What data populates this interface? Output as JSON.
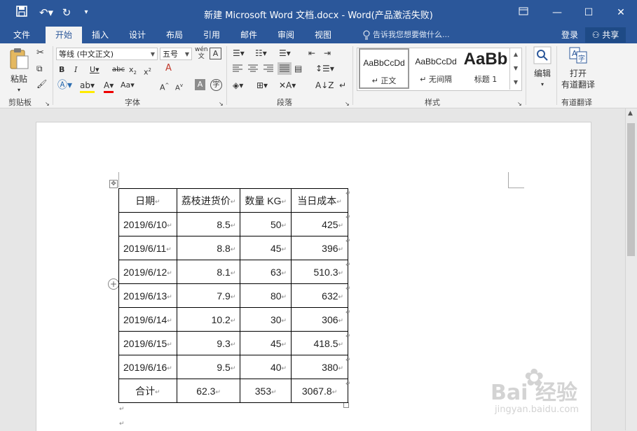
{
  "qat": {
    "save_icon": "save-icon",
    "undo_icon": "undo-icon",
    "redo_icon": "redo-icon",
    "customize_icon": "customize-icon"
  },
  "window": {
    "title": "新建 Microsoft Word 文档.docx - Word(产品激活失败)"
  },
  "tabs": [
    "文件",
    "开始",
    "插入",
    "设计",
    "布局",
    "引用",
    "邮件",
    "审阅",
    "视图"
  ],
  "active_tab": "开始",
  "tellme": "告诉我您想要做什么...",
  "account": {
    "login": "登录",
    "share": "共享"
  },
  "clipboard": {
    "paste": "粘贴",
    "label": "剪贴板"
  },
  "font": {
    "name": "等线 (中文正文)",
    "size": "五号",
    "label": "字体",
    "phonetic": "wén"
  },
  "paragraph": {
    "label": "段落"
  },
  "styles": {
    "items": [
      {
        "sample": "AaBbCcDd",
        "name": "↵ 正文"
      },
      {
        "sample": "AaBbCcDd",
        "name": "↵ 无间隔"
      },
      {
        "sample": "AaBb",
        "name": "标题 1"
      }
    ],
    "label": "样式"
  },
  "editing": {
    "label": "编辑"
  },
  "youdao": {
    "line1": "打开",
    "line2": "有道翻译",
    "label": "有道翻译"
  },
  "table": {
    "headers": [
      "日期",
      "荔枝进货价",
      "数量 KG",
      "当日成本"
    ],
    "rows": [
      [
        "2019/6/10",
        "8.5",
        "50",
        "425"
      ],
      [
        "2019/6/11",
        "8.8",
        "45",
        "396"
      ],
      [
        "2019/6/12",
        "8.1",
        "63",
        "510.3"
      ],
      [
        "2019/6/13",
        "7.9",
        "80",
        "632"
      ],
      [
        "2019/6/14",
        "10.2",
        "30",
        "306"
      ],
      [
        "2019/6/15",
        "9.3",
        "45",
        "418.5"
      ],
      [
        "2019/6/16",
        "9.5",
        "40",
        "380"
      ],
      [
        "合计",
        "62.3",
        "353",
        "3067.8"
      ]
    ]
  },
  "watermark": {
    "brand": "Bai  经验",
    "url": "jingyan.baidu.com"
  }
}
